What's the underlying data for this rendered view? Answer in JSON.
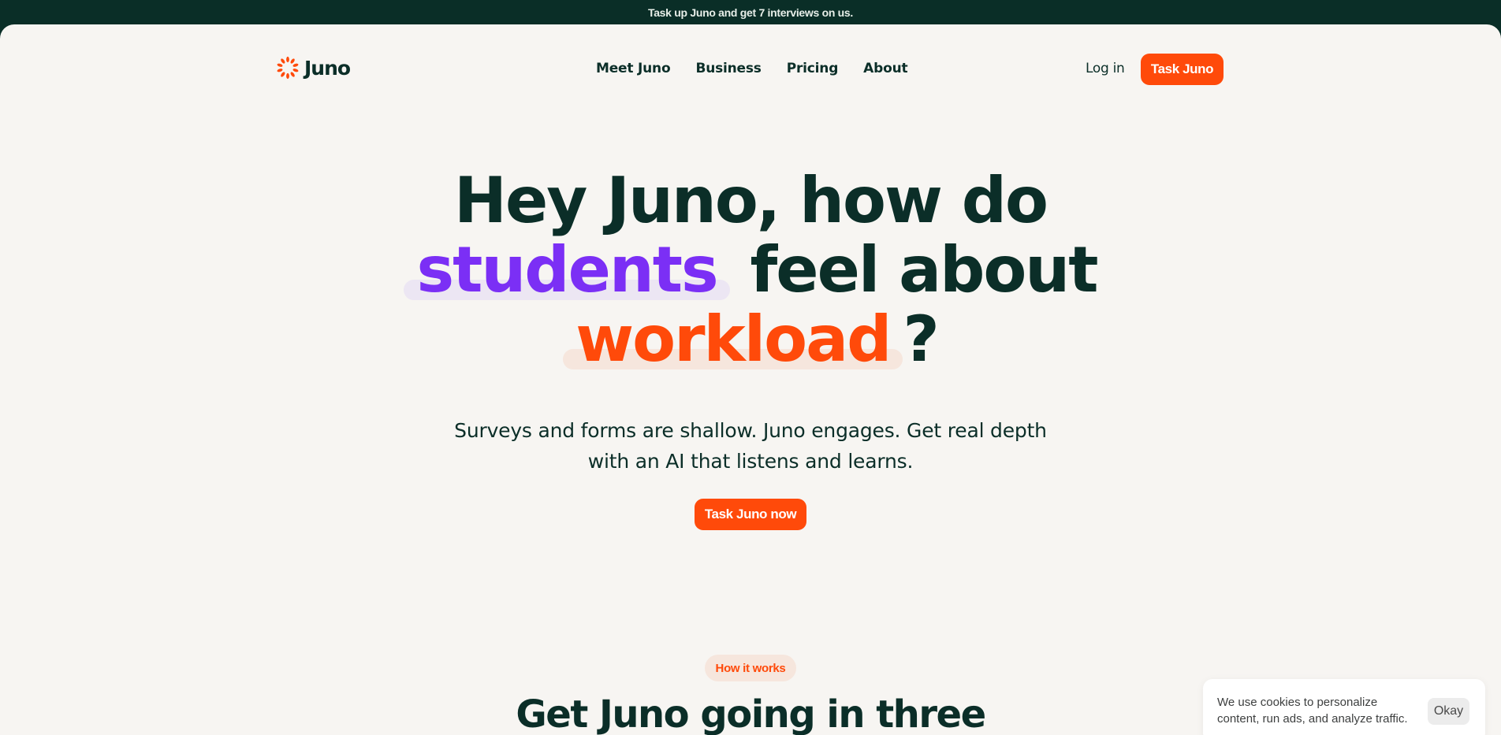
{
  "announcement": {
    "text": "Task up Juno and get 7 interviews on us."
  },
  "brand": {
    "name": "Juno",
    "logo_icon": "sunburst-icon",
    "accent_color": "#ff4a0a"
  },
  "nav": {
    "items": [
      {
        "label": "Meet Juno"
      },
      {
        "label": "Business"
      },
      {
        "label": "Pricing"
      },
      {
        "label": "About"
      }
    ],
    "login_label": "Log in",
    "cta_label": "Task Juno"
  },
  "hero": {
    "line1": "Hey Juno, how do",
    "highlight_audience": "students",
    "line2_rest": "feel about",
    "highlight_topic": "workload",
    "question_mark": "?",
    "subtitle": "Surveys and forms are shallow. Juno engages. Get real depth with an AI that listens and learns.",
    "cta_label": "Task Juno now",
    "colors": {
      "audience": "#7b2ff5",
      "topic": "#ff4a0a",
      "text": "#0b2e28"
    }
  },
  "how_it_works": {
    "badge": "How it works",
    "title": "Get Juno going in three"
  },
  "cookie_banner": {
    "text": "We use cookies to personalize content, run ads, and analyze traffic.",
    "button_label": "Okay"
  }
}
